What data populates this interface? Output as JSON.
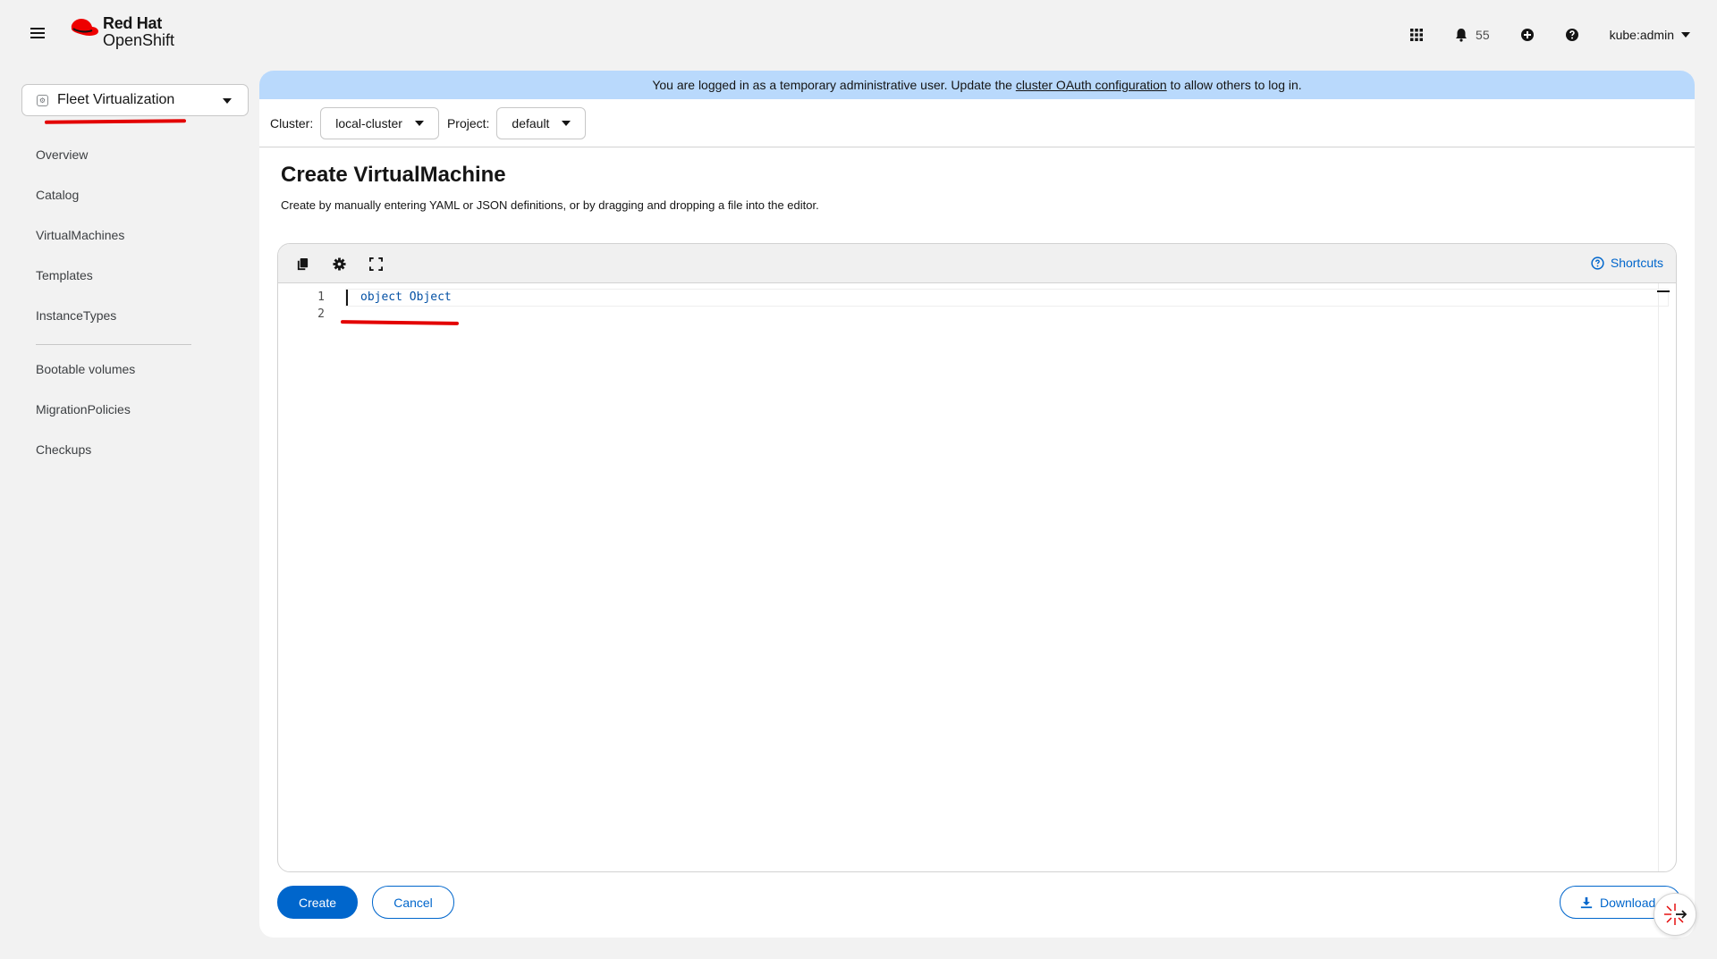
{
  "masthead": {
    "brand_line1": "Red Hat",
    "brand_line2": "OpenShift",
    "notifications_count": "55",
    "user_menu_label": "kube:admin"
  },
  "sidebar": {
    "perspective_label": "Fleet Virtualization",
    "items": [
      {
        "label": "Overview"
      },
      {
        "label": "Catalog"
      },
      {
        "label": "VirtualMachines"
      },
      {
        "label": "Templates"
      },
      {
        "label": "InstanceTypes"
      },
      {
        "label": "Bootable volumes"
      },
      {
        "label": "MigrationPolicies"
      },
      {
        "label": "Checkups"
      }
    ]
  },
  "banner": {
    "text_before": "You are logged in as a temporary administrative user. Update the ",
    "link_text": "cluster OAuth configuration",
    "text_after": " to allow others to log in."
  },
  "selectors": {
    "cluster_label": "Cluster:",
    "cluster_value": "local-cluster",
    "project_label": "Project:",
    "project_value": "default"
  },
  "page": {
    "title": "Create VirtualMachine",
    "description": "Create by manually entering YAML or JSON definitions, or by dragging and dropping a file into the editor."
  },
  "editor": {
    "shortcuts_label": "Shortcuts",
    "line_numbers": [
      "1",
      "2"
    ],
    "line1_code": "object Object"
  },
  "actions": {
    "create_label": "Create",
    "cancel_label": "Cancel",
    "download_label": "Download"
  },
  "colors": {
    "accent": "#0066cc",
    "banner": "#b9d9fc",
    "annotation": "#e30000",
    "brand_red": "#ee0000"
  },
  "icons": {
    "masthead": [
      "hamburger-icon",
      "redhat-logo-icon",
      "app-launcher-icon",
      "bell-icon",
      "plus-circle-icon",
      "help-icon",
      "caret-down-icon"
    ],
    "editor_toolbar": [
      "copy-icon",
      "gear-icon",
      "expand-icon",
      "question-circle-icon"
    ],
    "actions": [
      "download-icon",
      "lightspeed-icon"
    ]
  }
}
